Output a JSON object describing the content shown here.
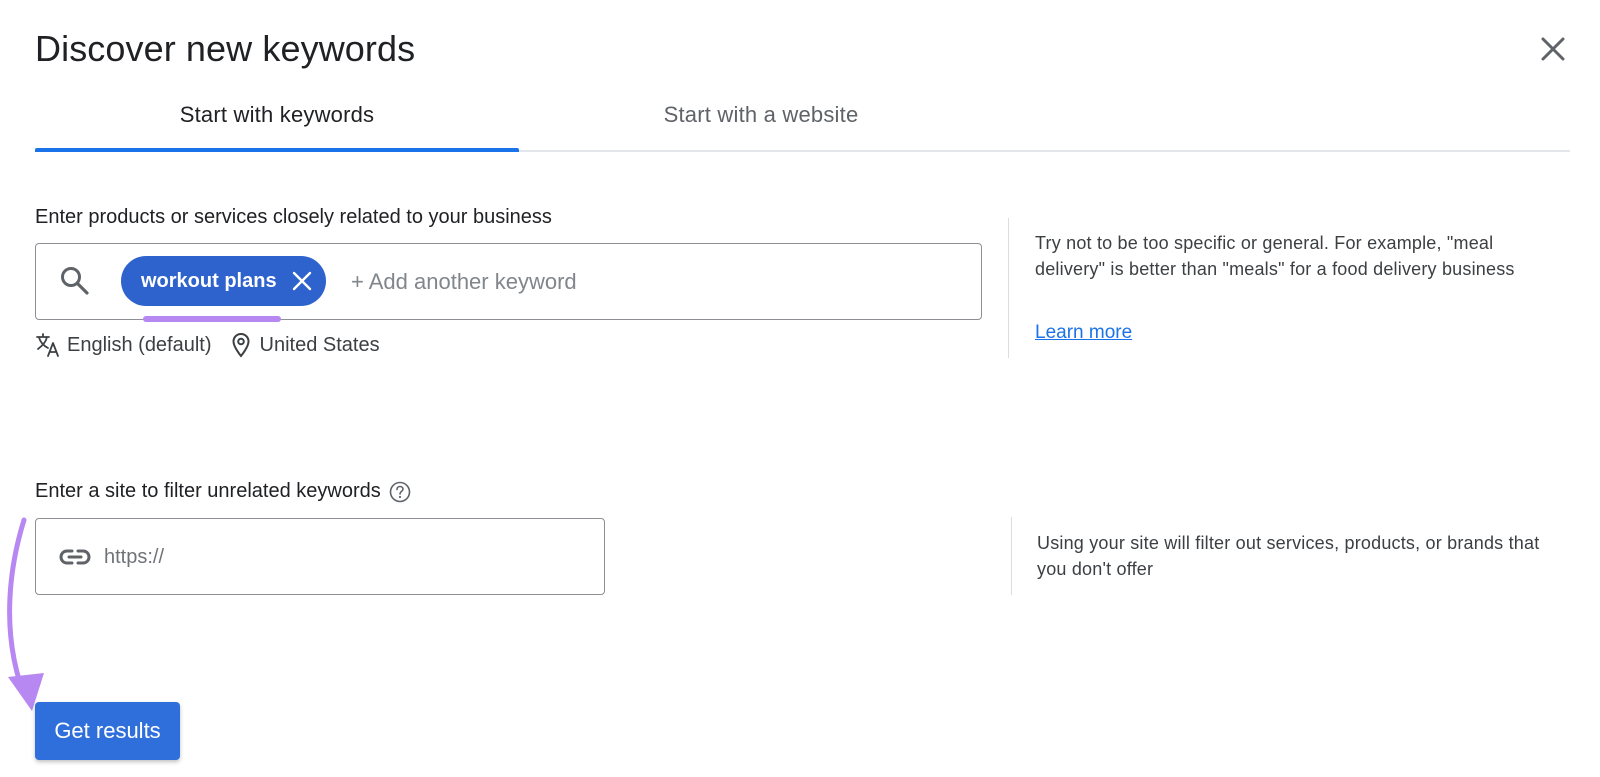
{
  "dialog": {
    "title": "Discover new keywords",
    "close_icon": "close-icon"
  },
  "tabs": [
    {
      "label": "Start with keywords",
      "active": true
    },
    {
      "label": "Start with a website",
      "active": false
    }
  ],
  "keywords_section": {
    "label": "Enter products or services closely related to your business",
    "search_icon": "search-icon",
    "chips": [
      {
        "label": "workout plans",
        "remove_icon": "close-icon"
      }
    ],
    "input_placeholder": "+ Add another keyword",
    "language": "English (default)",
    "location": "United States",
    "help_text": "Try not to be too specific or general. For example, \"meal delivery\" is better than \"meals\" for a food delivery business",
    "learn_more": "Learn more"
  },
  "site_section": {
    "label": "Enter a site to filter unrelated keywords",
    "help_icon": "help-circle-icon",
    "link_icon": "link-icon",
    "input_placeholder": "https://",
    "help_text": "Using your site will filter out services, products, or brands that you don't offer"
  },
  "actions": {
    "get_results": "Get results"
  },
  "colors": {
    "accent": "#1a73e8",
    "chip": "#2e62cc",
    "button": "#2f6fdc",
    "annotation": "#b888f2"
  }
}
